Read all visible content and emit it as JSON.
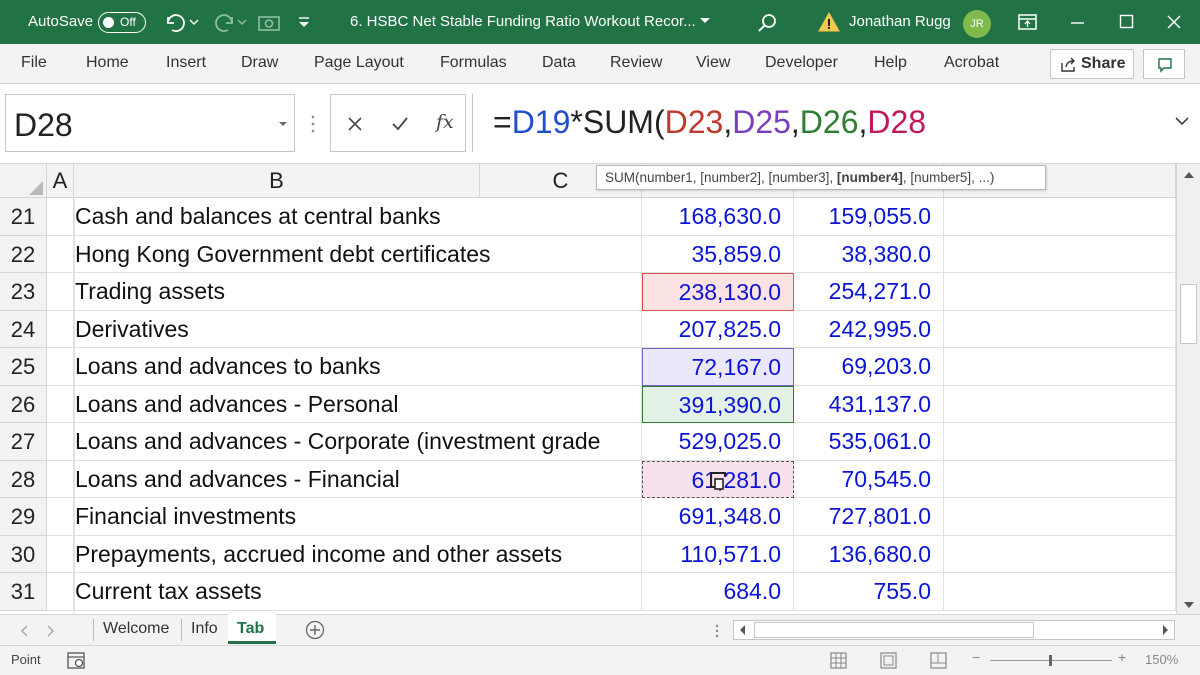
{
  "titlebar": {
    "autosave_label": "AutoSave",
    "autosave_state": "Off",
    "filename": "6. HSBC Net Stable Funding Ratio Workout Recor...",
    "user_name": "Jonathan Rugg",
    "user_initials": "JR"
  },
  "ribbon": {
    "tabs": [
      "File",
      "Home",
      "Insert",
      "Draw",
      "Page Layout",
      "Formulas",
      "Data",
      "Review",
      "View",
      "Developer",
      "Help",
      "Acrobat"
    ],
    "share_label": "Share"
  },
  "formula_bar": {
    "name_box": "D28",
    "fx_label": "fx",
    "formula_parts": [
      {
        "text": "=",
        "color": "#222222"
      },
      {
        "text": "D19",
        "color": "#1f4fcf"
      },
      {
        "text": "*SUM(",
        "color": "#222222"
      },
      {
        "text": "D23",
        "color": "#c0392b"
      },
      {
        "text": ",",
        "color": "#222222"
      },
      {
        "text": "D25",
        "color": "#7a3fbf"
      },
      {
        "text": ",",
        "color": "#222222"
      },
      {
        "text": "D26",
        "color": "#2e7d32"
      },
      {
        "text": ",",
        "color": "#222222"
      },
      {
        "text": "D28",
        "color": "#c2185b"
      }
    ]
  },
  "tooltip": {
    "before": "SUM(number1, [number2], [number3], ",
    "bold": "[number4]",
    "after": ", [number5], ...)"
  },
  "grid": {
    "columns": [
      "A",
      "B",
      "C"
    ],
    "rows": [
      {
        "row": "21",
        "label": "Cash and balances at central banks",
        "d": "168,630.0",
        "e": "159,055.0"
      },
      {
        "row": "22",
        "label": "Hong Kong Government debt certificates",
        "d": "35,859.0",
        "e": "38,380.0"
      },
      {
        "row": "23",
        "label": "Trading assets",
        "d": "238,130.0",
        "e": "254,271.0"
      },
      {
        "row": "24",
        "label": "Derivatives",
        "d": "207,825.0",
        "e": "242,995.0"
      },
      {
        "row": "25",
        "label": "Loans and advances to banks",
        "d": "72,167.0",
        "e": "69,203.0"
      },
      {
        "row": "26",
        "label": "Loans and advances - Personal",
        "d": "391,390.0",
        "e": "431,137.0"
      },
      {
        "row": "27",
        "label": "Loans and advances - Corporate (investment grade",
        "d": "529,025.0",
        "e": "535,061.0"
      },
      {
        "row": "28",
        "label": "Loans and advances - Financial",
        "d": "61,281.0",
        "e": "70,545.0"
      },
      {
        "row": "29",
        "label": "Financial investments",
        "d": "691,348.0",
        "e": "727,801.0"
      },
      {
        "row": "30",
        "label": "Prepayments, accrued income and other assets",
        "d": "110,571.0",
        "e": "136,680.0"
      },
      {
        "row": "31",
        "label": "Current tax assets",
        "d": "684.0",
        "e": "755.0"
      }
    ],
    "highlights": {
      "23": {
        "fill": "#fbe3e3",
        "border": "#d9534f",
        "style": "solid"
      },
      "25": {
        "fill": "#ece8fb",
        "border": "#7b61c9",
        "style": "solid"
      },
      "26": {
        "fill": "#e3f1e6",
        "border": "#2e7d32",
        "style": "solid"
      },
      "28": {
        "fill": "#f7e1ec",
        "border": "#555555",
        "style": "dashed"
      }
    }
  },
  "sheets": {
    "tabs": [
      "Welcome",
      "Info",
      "Tab"
    ],
    "active": "Tab",
    "active_color": "#217346"
  },
  "status": {
    "mode": "Point",
    "zoom": "150%"
  },
  "colors": {
    "brand": "#217346",
    "number_text": "#0a14d6"
  }
}
